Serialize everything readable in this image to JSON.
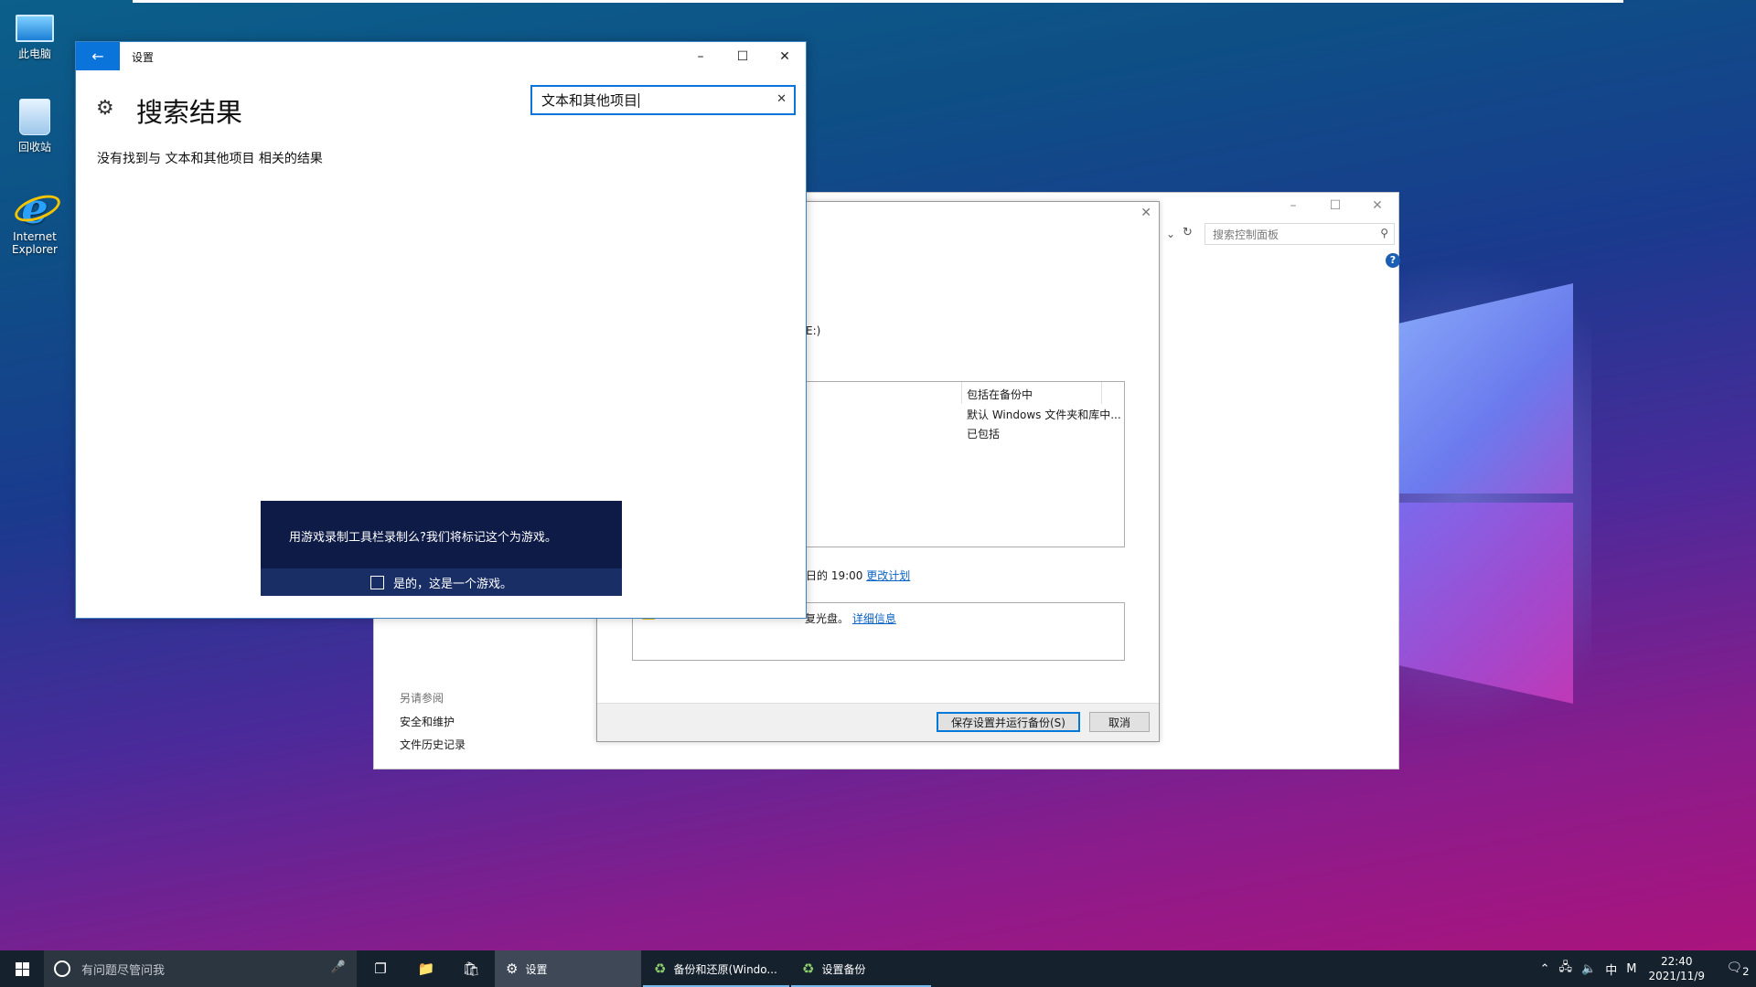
{
  "desktop": {
    "icons": [
      {
        "label": "此电脑"
      },
      {
        "label": "回收站"
      },
      {
        "label": "Internet Explorer"
      }
    ]
  },
  "settings_window": {
    "title": "设置",
    "page_heading": "搜索结果",
    "search_value": "文本和其他项目",
    "no_result_text": "没有找到与 文本和其他项目 相关的结果",
    "game_bar": {
      "message": "用游戏录制工具栏录制么?我们将标记这个为游戏。",
      "checkbox_label": "是的，这是一个游戏。"
    }
  },
  "control_panel_window": {
    "search_placeholder": "搜索控制面板",
    "see_also_header": "另请参阅",
    "links": [
      "安全和维护",
      "文件历史记录"
    ]
  },
  "backup_dialog": {
    "drive_text": "E:)",
    "list_rows": [
      "包括在备份中",
      "默认 Windows 文件夹和库中...",
      "已包括"
    ],
    "schedule_text": "日的 19:00",
    "schedule_link": "更改计划",
    "warning_text": "复光盘。",
    "warning_link": "详细信息",
    "save_button": "保存设置并运行备份(S)",
    "cancel_button": "取消"
  },
  "taskbar": {
    "search_placeholder": "有问题尽管问我",
    "apps": [
      {
        "label": "设置"
      },
      {
        "label": "备份和还原(Windo..."
      },
      {
        "label": "设置备份"
      }
    ],
    "ime_label": "中",
    "ime_mode": "M",
    "time": "22:40",
    "date": "2021/11/9",
    "notification_count": "2"
  }
}
